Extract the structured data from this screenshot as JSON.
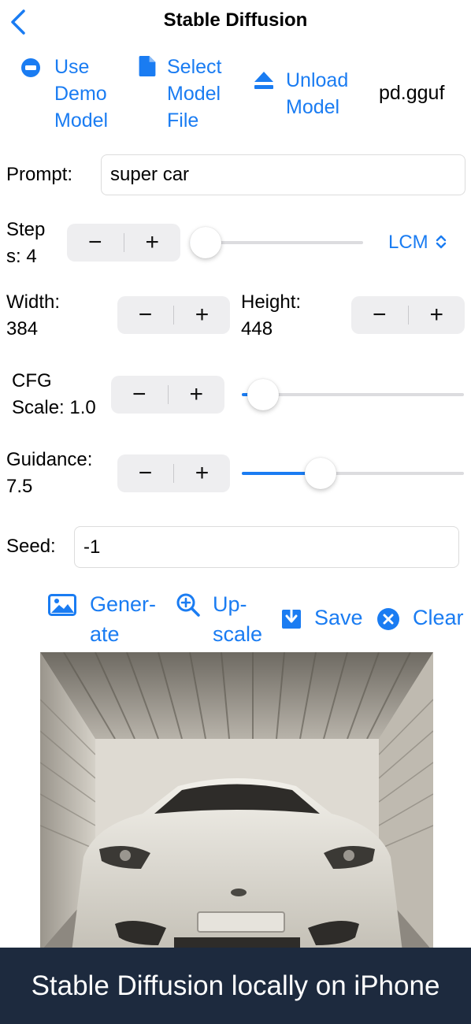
{
  "nav": {
    "title": "Stable Diffusion",
    "back_icon": "chevron-left-icon"
  },
  "model_actions": {
    "use_demo": {
      "line1": "Use",
      "line2": "Demo",
      "line3": "Model",
      "icon": "minus-circle-icon"
    },
    "select_file": {
      "line1": "Select",
      "line2": "Model",
      "line3": "File",
      "icon": "document-icon"
    },
    "unload": {
      "line1": "Unload",
      "line2": "Model",
      "icon": "eject-icon"
    },
    "filename": "pd.gguf"
  },
  "prompt": {
    "label": "Prompt:",
    "value": "super car"
  },
  "steps": {
    "label_line1": "Step",
    "label_line2": "s: 4",
    "value": 4,
    "slider_fraction": 0.0,
    "sampler": "LCM"
  },
  "width": {
    "label": "Width:",
    "value": "384"
  },
  "height": {
    "label": "Height:",
    "value": "448"
  },
  "cfg": {
    "label_line1": "CFG",
    "label_line2": "Scale: 1.0",
    "slider_fraction": 0.03
  },
  "guidance": {
    "label_line1": "Guidance:",
    "label_line2": "7.5",
    "slider_fraction": 0.33
  },
  "seed": {
    "label": "Seed:",
    "value": "-1"
  },
  "actions": {
    "generate": {
      "line1": "Gener-",
      "line2": "ate",
      "icon": "photo-icon"
    },
    "upscale": {
      "line1": "Up-",
      "line2": "scale",
      "icon": "zoom-in-icon"
    },
    "save": {
      "label": "Save",
      "icon": "download-icon"
    },
    "clear": {
      "label": "Clear",
      "icon": "close-circle-icon"
    }
  },
  "stepper": {
    "minus": "−",
    "plus": "+"
  },
  "colors": {
    "accent": "#1a7cf2",
    "caption_bg": "#1d2a3e"
  },
  "caption": "Stable Diffusion locally on iPhone"
}
